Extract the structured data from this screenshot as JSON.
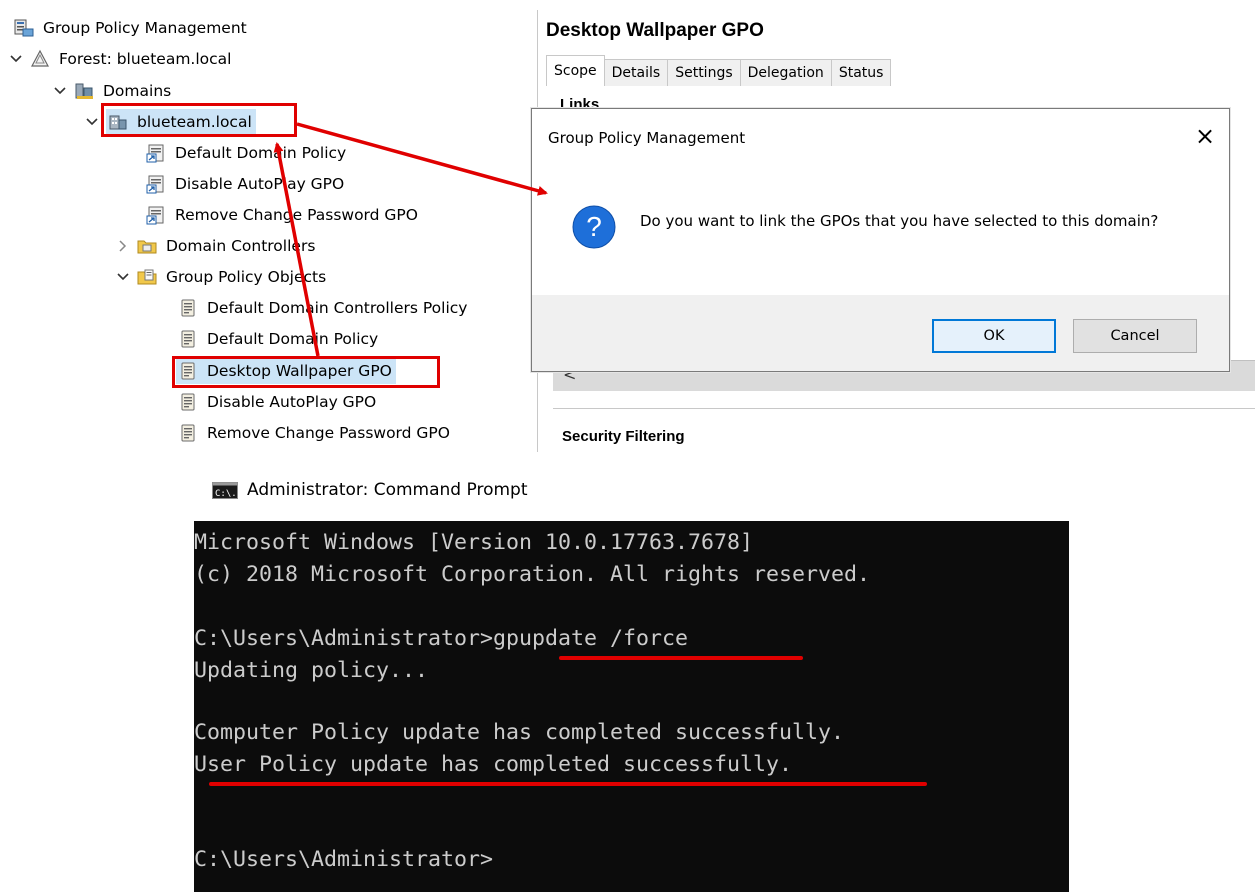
{
  "gpmc": {
    "root": "Group Policy Management",
    "forest": "Forest: blueteam.local",
    "domains": "Domains",
    "domain": "blueteam.local",
    "linked_gpos": [
      "Default Domain Policy",
      "Disable AutoPlay GPO",
      "Remove Change Password GPO"
    ],
    "domain_controllers": "Domain Controllers",
    "gpo_container": "Group Policy Objects",
    "gpo_objects": [
      "Default Domain Controllers Policy",
      "Default Domain Policy",
      "Desktop Wallpaper GPO",
      "Disable AutoPlay GPO",
      "Remove Change Password GPO"
    ]
  },
  "right_pane": {
    "title": "Desktop Wallpaper GPO",
    "tabs": [
      "Scope",
      "Details",
      "Settings",
      "Delegation",
      "Status"
    ],
    "active_tab": "Scope",
    "links_label": "Links",
    "security_filtering_label": "Security Filtering",
    "scroll_left_glyph": "<"
  },
  "dialog": {
    "title": "Group Policy Management",
    "close_glyph": "×",
    "message": "Do you want to link the GPOs that you have selected to this domain?",
    "ok_label": "OK",
    "cancel_label": "Cancel",
    "icon": "question-icon"
  },
  "cmd": {
    "title": "Administrator: Command Prompt",
    "lines": [
      "Microsoft Windows [Version 10.0.17763.7678]",
      "(c) 2018 Microsoft Corporation. All rights reserved.",
      "",
      "C:\\Users\\Administrator>gpupdate /force",
      "Updating policy...",
      "",
      "Computer Policy update has completed successfully.",
      "User Policy update has completed successfully.",
      "",
      "",
      "C:\\Users\\Administrator>"
    ]
  },
  "annotation_color": "#e00000"
}
